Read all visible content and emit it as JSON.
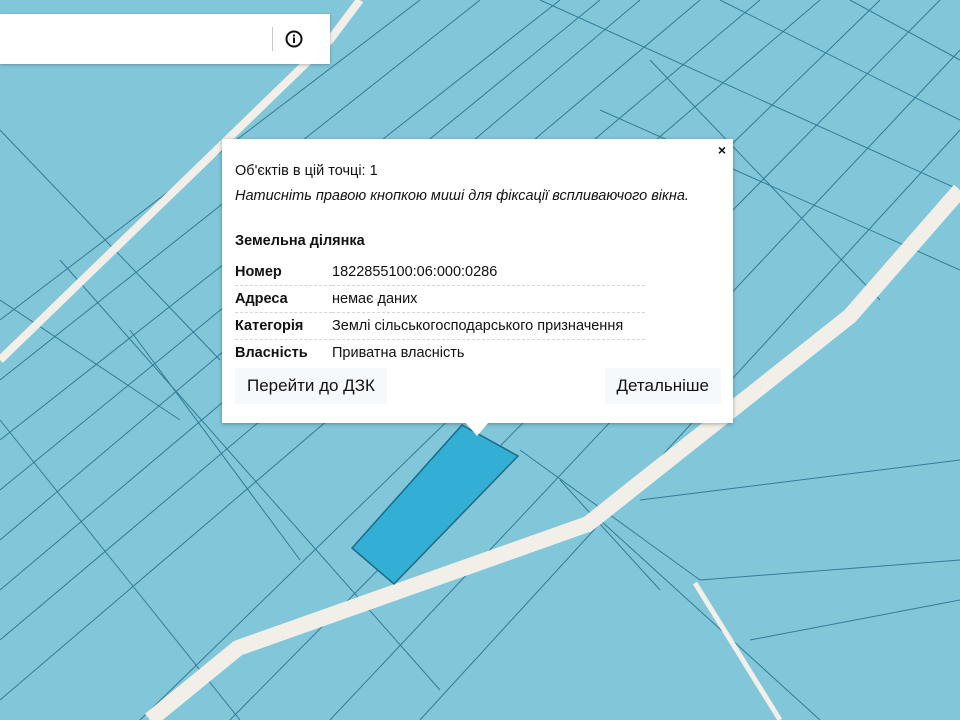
{
  "search": {
    "placeholder": "",
    "value": "",
    "info_icon": "info-circle-icon"
  },
  "map": {
    "background_color": "#82c6d9",
    "parcel_border_color": "#1d6a86",
    "road_color": "#f2efe8",
    "selected_parcel_color": "#33aed4"
  },
  "popup": {
    "close_label": "×",
    "objects_count": "Об'єктів в цій точці: 1",
    "hint": "Натисніть правою кнопкою миші для фіксації вспливаючого вікна.",
    "section_title": "Земельна ділянка",
    "properties": [
      {
        "key": "Номер",
        "value": "1822855100:06:000:0286"
      },
      {
        "key": "Адреса",
        "value": "немає даних"
      },
      {
        "key": "Категорія",
        "value": "Землі сільськогосподарського призначення"
      },
      {
        "key": "Власність",
        "value": "Приватна власність"
      }
    ],
    "button_go": "Перейти до ДЗК",
    "button_details": "Детальніше"
  }
}
